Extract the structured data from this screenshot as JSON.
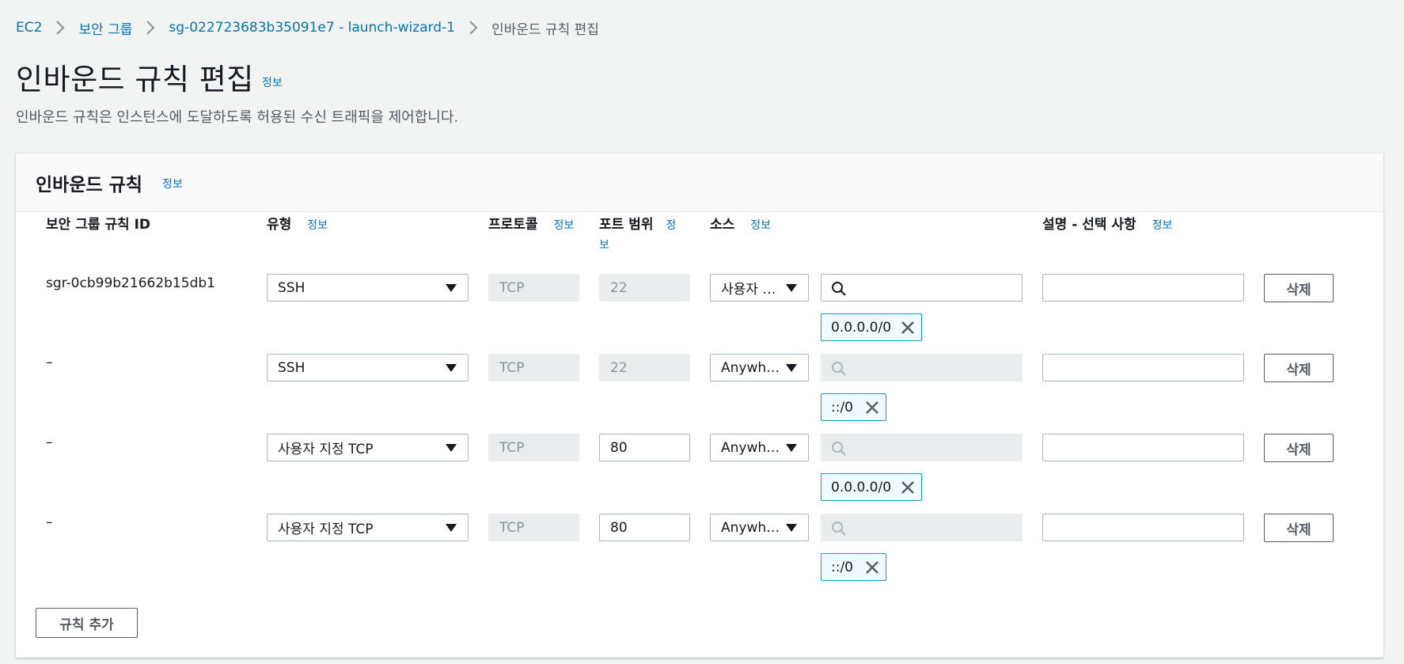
{
  "breadcrumb": {
    "items": [
      "EC2",
      "보안 그룹",
      "sg-022723683b35091e7 - launch-wizard-1"
    ],
    "current": "인바운드 규칙 편집"
  },
  "page": {
    "title": "인바운드 규칙 편집",
    "info": "정보",
    "subtitle": "인바운드 규칙은 인스턴스에 도달하도록 허용된 수신 트래픽을 제어합니다."
  },
  "panel": {
    "title": "인바운드 규칙",
    "info": "정보",
    "columns": {
      "rule_id": "보안 그룹 규칙 ID",
      "type": "유형",
      "protocol": "프로토콜",
      "port": "포트 범위",
      "source": "소스",
      "description": "설명 - 선택 사항",
      "info": "정보"
    },
    "rows": [
      {
        "id": "sgr-0cb99b21662b15db1",
        "type": "SSH",
        "protocol": "TCP",
        "port": "22",
        "source": "사용자 …",
        "token": "0.0.0.0/0",
        "delete": "삭제"
      },
      {
        "id": "–",
        "type": "SSH",
        "protocol": "TCP",
        "port": "22",
        "source": "Anywh…",
        "token": "::/0",
        "delete": "삭제"
      },
      {
        "id": "–",
        "type": "사용자 지정 TCP",
        "protocol": "TCP",
        "port": "80",
        "source": "Anywh…",
        "token": "0.0.0.0/0",
        "delete": "삭제"
      },
      {
        "id": "–",
        "type": "사용자 지정 TCP",
        "protocol": "TCP",
        "port": "80",
        "source": "Anywh…",
        "token": "::/0",
        "delete": "삭제"
      }
    ],
    "add_rule": "규칙 추가"
  }
}
